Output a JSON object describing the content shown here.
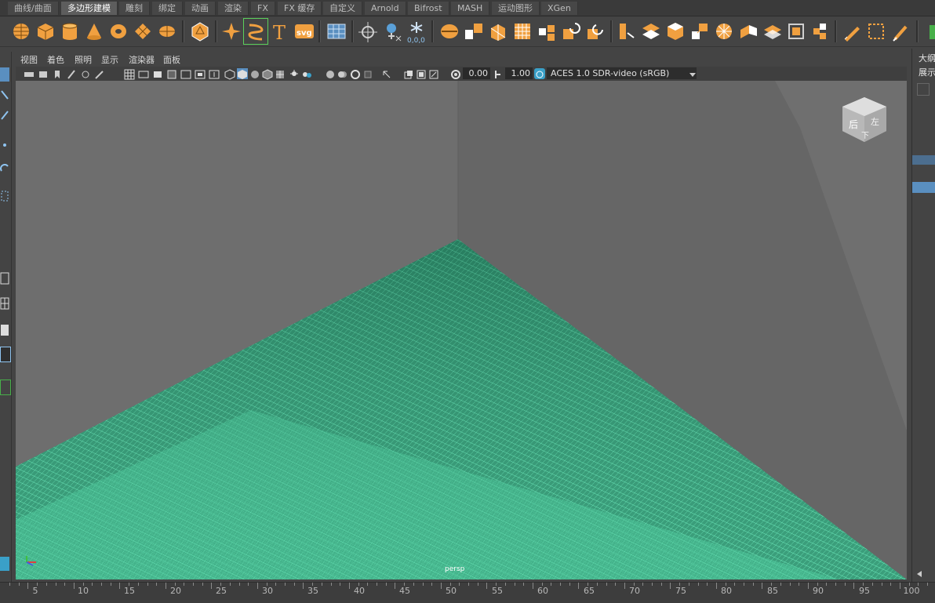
{
  "shelf_tabs": [
    "曲线/曲面",
    "多边形建模",
    "雕刻",
    "绑定",
    "动画",
    "渲染",
    "FX",
    "FX 缓存",
    "自定义",
    "Arnold",
    "Bifrost",
    "MASH",
    "运动图形",
    "XGen"
  ],
  "active_shelf_tab": "多边形建模",
  "shelf_text_tool_glyph": "T",
  "shelf_svg_tool_text": "svg",
  "shelf_snap_readout": "0,0,0",
  "panel_menu": [
    "视图",
    "着色",
    "照明",
    "显示",
    "渲染器",
    "面板"
  ],
  "exposure_value": "0.00",
  "gamma_value": "1.00",
  "color_space": "ACES 1.0 SDR-video (sRGB)",
  "viewcube_labels": {
    "side": "后",
    "top": "左",
    "bottom": "下"
  },
  "camera_label": "persp",
  "outliner": {
    "title": "大纲",
    "show_menu": "展示"
  },
  "timeline_labels": [
    "5",
    "10",
    "15",
    "20",
    "25",
    "30",
    "35",
    "40",
    "45",
    "50",
    "55",
    "60",
    "65",
    "70",
    "75",
    "80",
    "85",
    "90",
    "95",
    "100"
  ],
  "colors": {
    "ui_bg": "#444444",
    "viewport_bg": "#6b6b6b",
    "mesh_wire": "#5fe0b0",
    "mesh_fill": "#2e8a6a",
    "shelf_icon": "#f0a040",
    "selection_blue": "#5a8fc0"
  },
  "icons": {
    "shelf": [
      "sphere-icon",
      "cube-icon",
      "cylinder-icon",
      "cone-icon",
      "torus-icon",
      "plane-icon",
      "disc-icon",
      "platonic-icon",
      "superellipse-icon",
      "sweep-icon",
      "type-icon",
      "svg-icon",
      "grid-icon",
      "center-pivot-icon",
      "snap-icon",
      "freeze-icon",
      "combine-icon",
      "separate-icon",
      "smooth-icon",
      "extrude-icon",
      "bridge-icon",
      "bevel-icon",
      "fill-hole-icon",
      "multicut-icon",
      "target-weld-icon",
      "mirror-icon",
      "insert-edgeloop-icon",
      "offset-loop-icon",
      "quad-draw-icon",
      "relax-icon",
      "crease-icon"
    ]
  }
}
